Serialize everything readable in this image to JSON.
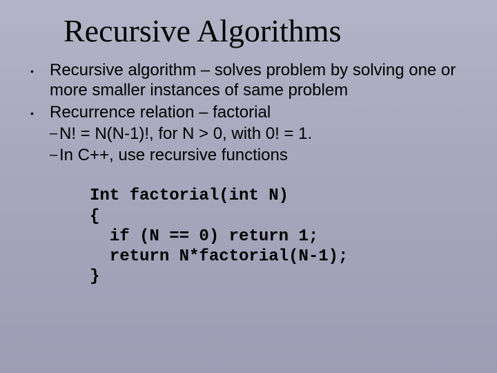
{
  "title": "Recursive Algorithms",
  "bullets": [
    {
      "text": "Recursive algorithm – solves problem by solving one or more smaller instances of same problem",
      "subs": []
    },
    {
      "text": "Recurrence relation – factorial",
      "subs": [
        "N! = N(N-1)!,    for N > 0, with 0! = 1.",
        "In C++, use recursive functions"
      ]
    }
  ],
  "code": "Int factorial(int N)\n{\n  if (N == 0) return 1;\n  return N*factorial(N-1);\n}"
}
